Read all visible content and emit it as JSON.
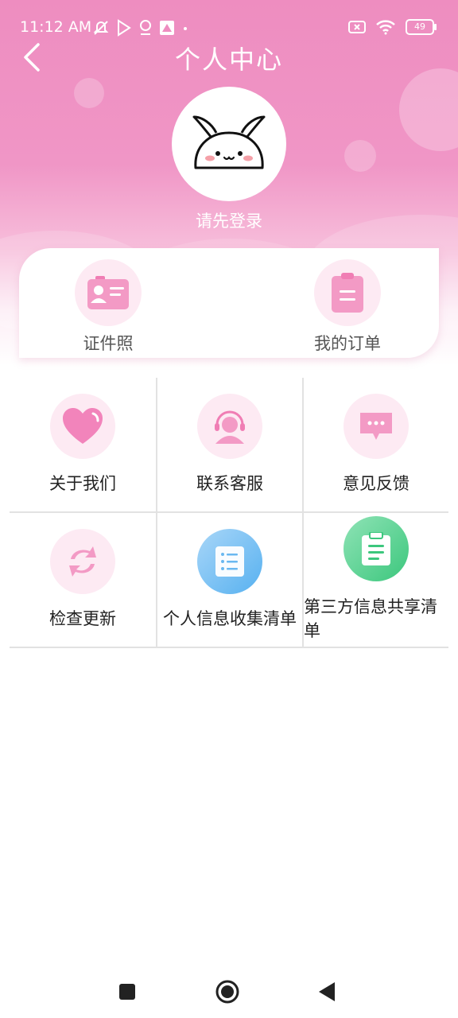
{
  "status_bar": {
    "time": "11:12 AM",
    "battery": "49",
    "icons": [
      "mute-icon",
      "play-store-icon",
      "location-icon",
      "app-icon",
      "dot-icon",
      "sim-off-icon",
      "wifi-icon",
      "battery-icon"
    ]
  },
  "header": {
    "title": "个人中心",
    "login_prompt": "请先登录"
  },
  "quick_actions": [
    {
      "label": "证件照",
      "icon": "id-card-icon"
    },
    {
      "label": "我的订单",
      "icon": "clipboard-icon"
    }
  ],
  "menu": [
    {
      "label": "关于我们",
      "icon": "heart-icon"
    },
    {
      "label": "联系客服",
      "icon": "customer-service-icon"
    },
    {
      "label": "意见反馈",
      "icon": "message-icon"
    },
    {
      "label": "检查更新",
      "icon": "refresh-icon"
    },
    {
      "label": "个人信息收集清单",
      "icon": "list-icon"
    },
    {
      "label": "第三方信息共享清单",
      "icon": "clipboard-list-icon"
    }
  ],
  "colors": {
    "header_pink": "#ee8dc0",
    "icon_pink": "#f07db4",
    "icon_circle": "#fdeaf3",
    "blue": "#57b1f0",
    "green": "#3cc77d"
  }
}
